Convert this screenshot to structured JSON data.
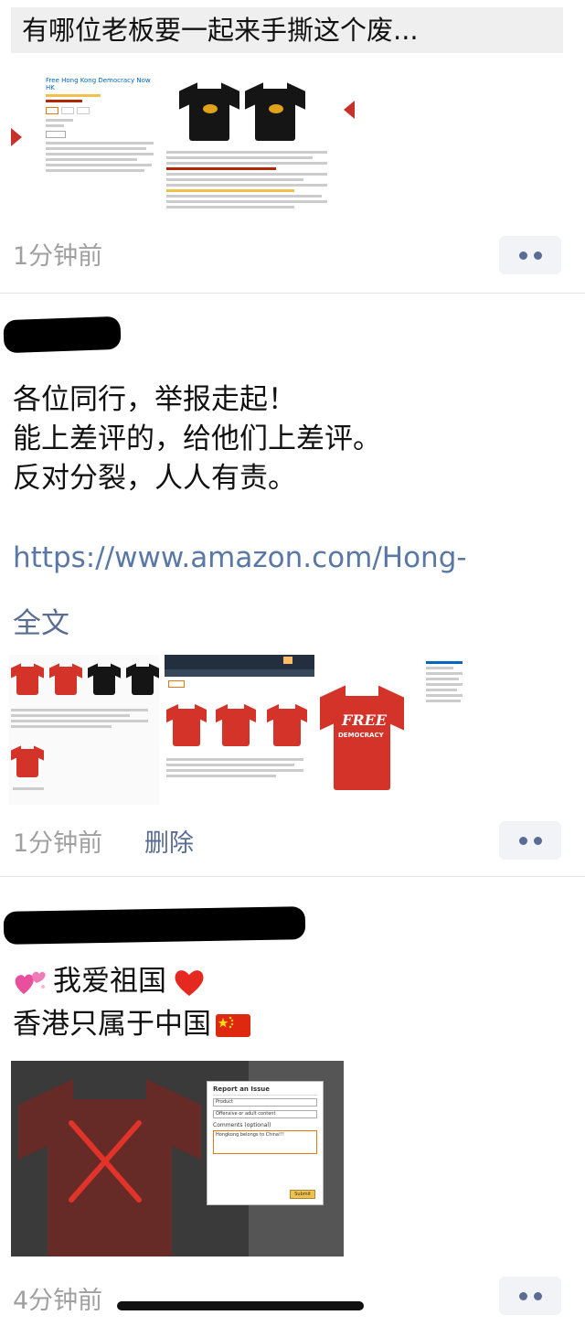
{
  "post1": {
    "shared_title": "有哪位老板要一起来手撕这个废...",
    "thumb_title": "Free Hong Kong Democracy Now HK",
    "time": "1分钟前"
  },
  "post2": {
    "lines": [
      "各位同行，举报走起！",
      "能上差评的，给他们上差评。",
      "反对分裂，人人有责。"
    ],
    "link": "https://www.amazon.com/Hong-",
    "fulltext": "全文",
    "shirt_text": "FREE",
    "shirt_sub": "DEMOCRACY",
    "time": "1分钟前",
    "delete": "删除"
  },
  "post3": {
    "line1_text": "我爱祖国",
    "line2_text": "香港只属于中国",
    "dialog": {
      "title": "Report an Issue",
      "select1": "Product",
      "select2": "Offensive or adult content",
      "comment_label": "Comments (optional)",
      "comment": "Hongkong belongs to China!!!",
      "submit": "Submit"
    },
    "time": "4分钟前"
  },
  "colors": {
    "link": "#5a78a5",
    "action_blue": "#5a6c94",
    "time_gray": "#a0a0a0",
    "shirt_red": "#d4332a",
    "shirt_black": "#151515"
  },
  "icons": {
    "more": "more-dots-icon",
    "heart_sparkle": "sparkling-hearts-icon",
    "heart": "red-heart-icon",
    "flag": "china-flag-icon",
    "cross": "red-x-icon"
  }
}
